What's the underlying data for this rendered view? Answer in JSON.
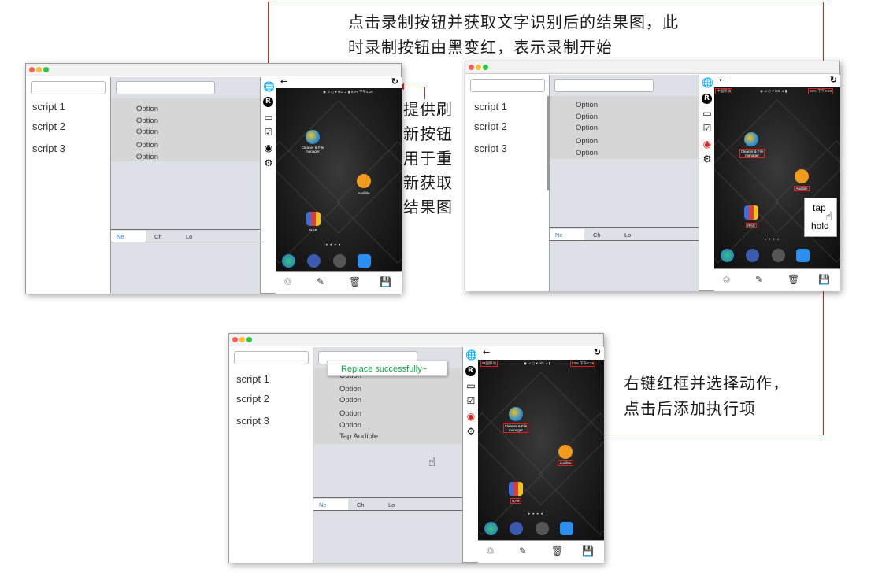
{
  "annotations": {
    "top_line1": "点击录制按钮并获取文字识别后的结果图，此",
    "top_line2": "时录制按钮由黑变红，表示录制开始",
    "refresh_lines": [
      "提供刷",
      "新按钮",
      "用于重",
      "新获取",
      "结果图"
    ],
    "right_line1": "右键红框并选择动作，",
    "right_line2": "点击后添加执行项"
  },
  "scripts": [
    "script 1",
    "script 2",
    "script 3"
  ],
  "options": [
    "Option",
    "Option",
    "Option",
    "Option",
    "Option"
  ],
  "tabs": [
    "Ne",
    "Ch",
    "Lo"
  ],
  "toast": "Replace successfully~",
  "added_item": "Tap Audible",
  "context_menu": [
    "tap",
    "hold"
  ],
  "phone": {
    "carrier": "中国移动",
    "status_right": "53% 下午4:28",
    "apps": {
      "cleaner": "Cleaner & File manager",
      "audible": "Audible",
      "rar": "RAR"
    }
  },
  "colors": {
    "annotation_red": "#e0201a",
    "toast_green": "#1aa34a",
    "tab_active": "#2a7ee8"
  }
}
